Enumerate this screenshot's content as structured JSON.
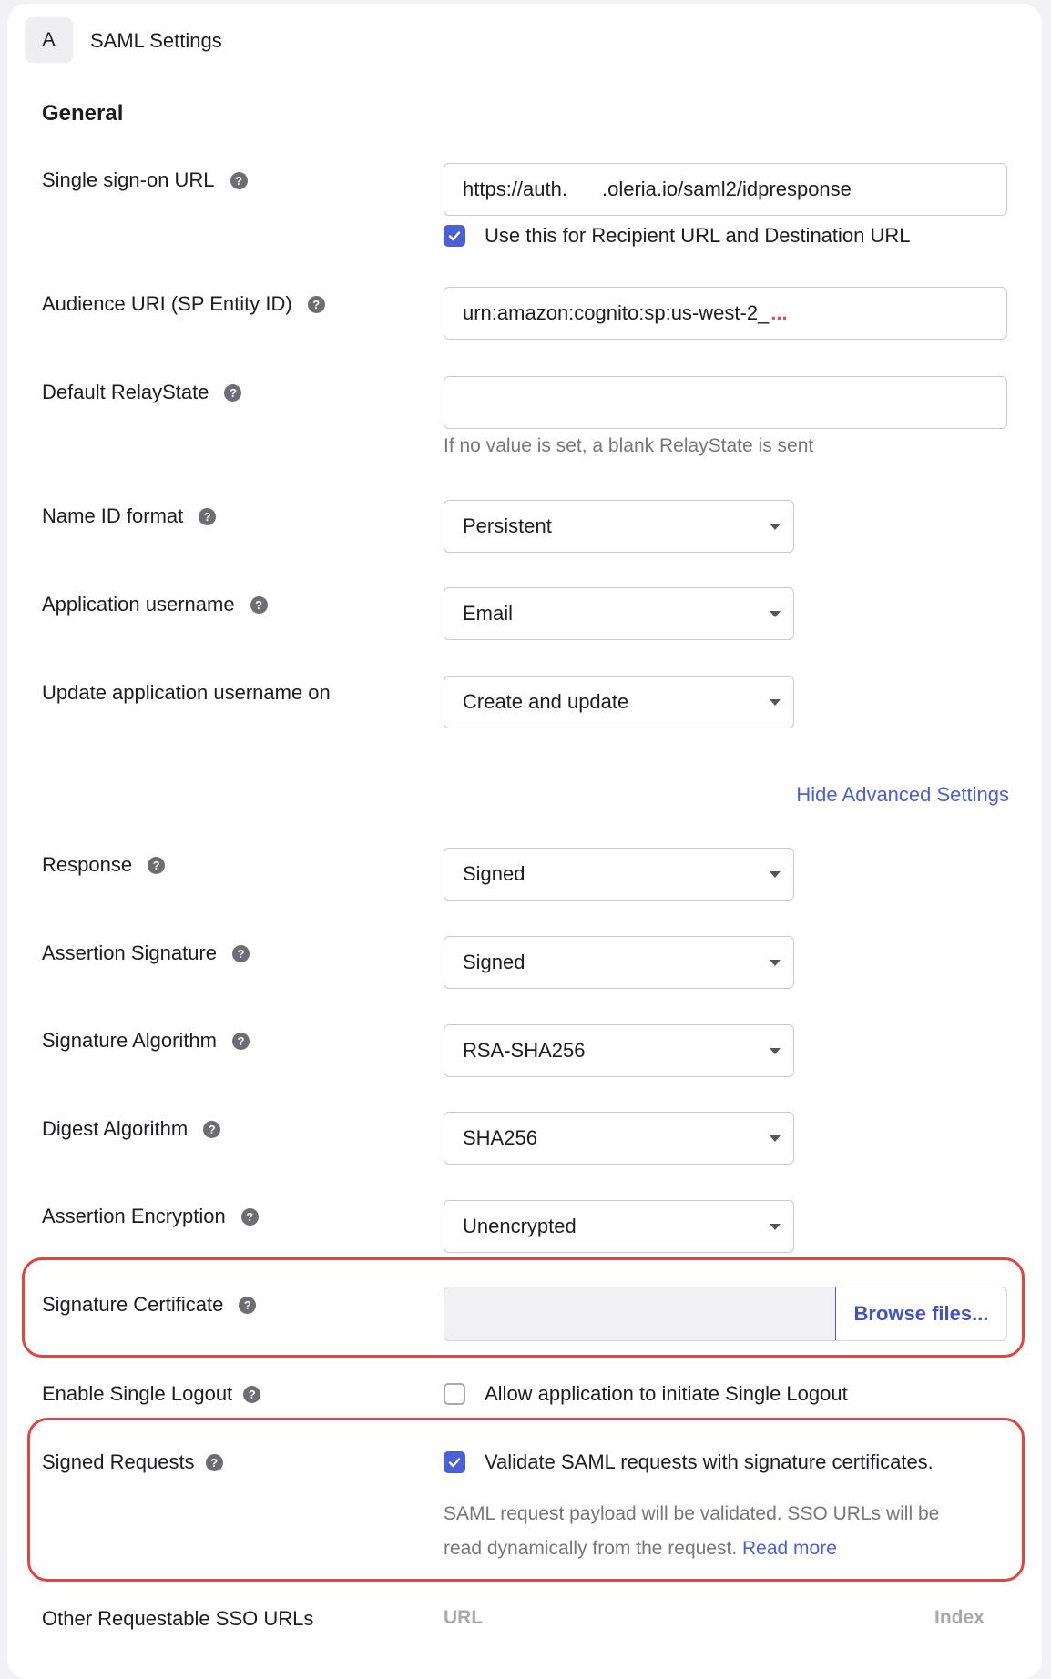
{
  "header": {
    "tab_badge": "A",
    "tab_title": "SAML Settings"
  },
  "section": {
    "title": "General"
  },
  "fields": {
    "sso_url": {
      "label": "Single sign-on URL",
      "value_part1": "https://auth.",
      "value_part2": ".oleria.io/saml2/idpresponse"
    },
    "recipient_checkbox": {
      "label": "Use this for Recipient URL and Destination URL",
      "checked": true
    },
    "audience_uri": {
      "label": "Audience URI (SP Entity ID)",
      "value": "urn:amazon:cognito:sp:us-west-2_",
      "truncation": "..."
    },
    "relay_state": {
      "label": "Default RelayState",
      "value": "",
      "hint": "If no value is set, a blank RelayState is sent"
    },
    "name_id_format": {
      "label": "Name ID format",
      "value": "Persistent"
    },
    "app_username": {
      "label": "Application username",
      "value": "Email"
    },
    "update_username_on": {
      "label": "Update application username on",
      "value": "Create and update"
    },
    "advanced_toggle": {
      "label": "Hide Advanced Settings"
    },
    "response": {
      "label": "Response",
      "value": "Signed"
    },
    "assertion_signature": {
      "label": "Assertion Signature",
      "value": "Signed"
    },
    "signature_algorithm": {
      "label": "Signature Algorithm",
      "value": "RSA-SHA256"
    },
    "digest_algorithm": {
      "label": "Digest Algorithm",
      "value": "SHA256"
    },
    "assertion_encryption": {
      "label": "Assertion Encryption",
      "value": "Unencrypted"
    },
    "signature_certificate": {
      "label": "Signature Certificate",
      "button": "Browse files..."
    },
    "single_logout": {
      "label": "Enable Single Logout",
      "checkbox_label": "Allow application to initiate Single Logout",
      "checked": false
    },
    "signed_requests": {
      "label": "Signed Requests",
      "checkbox_label": "Validate SAML requests with signature certificates.",
      "checked": true,
      "hint_line1": "SAML request payload will be validated. SSO URLs will be",
      "hint_line2": "read dynamically from the request.",
      "read_more": "Read more"
    },
    "other_sso_urls": {
      "label": "Other Requestable SSO URLs",
      "col_url": "URL",
      "col_index": "Index"
    }
  },
  "icons": {
    "help": "?"
  },
  "colors": {
    "accent": "#4b5fd6",
    "highlight": "#e2453a"
  }
}
